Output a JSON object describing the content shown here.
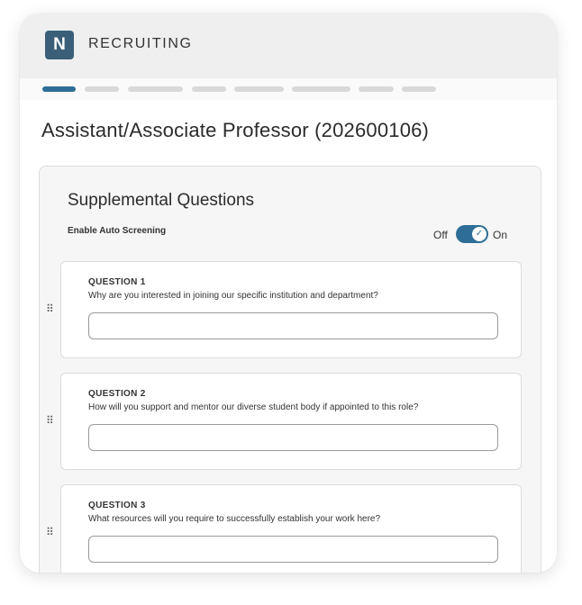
{
  "header": {
    "logo_letter": "N",
    "app_title": "RECRUITING"
  },
  "progress": {
    "total_steps": 8,
    "current_step": 1
  },
  "page": {
    "title": "Assistant/Associate Professor (202600106)"
  },
  "supplemental": {
    "title": "Supplemental Questions",
    "auto_screening_label": "Enable Auto Screening",
    "toggle_off_label": "Off",
    "toggle_on_label": "On",
    "toggle_state": "on",
    "questions": [
      {
        "label": "QUESTION 1",
        "text": "Why are you interested in joining our specific institution and department?",
        "answer": ""
      },
      {
        "label": "QUESTION 2",
        "text": "How will you support and mentor our diverse student body if appointed to this role?",
        "answer": ""
      },
      {
        "label": "QUESTION 3",
        "text": "What resources will you require to successfully establish your work here?",
        "answer": ""
      }
    ]
  },
  "colors": {
    "accent": "#2e6e96",
    "logo_bg": "#3b5f78",
    "header_bg": "#efefef",
    "panel_bg": "#f6f6f6"
  },
  "icons": {
    "toggle_check": "check-icon",
    "drag": "drag-handle-icon"
  }
}
